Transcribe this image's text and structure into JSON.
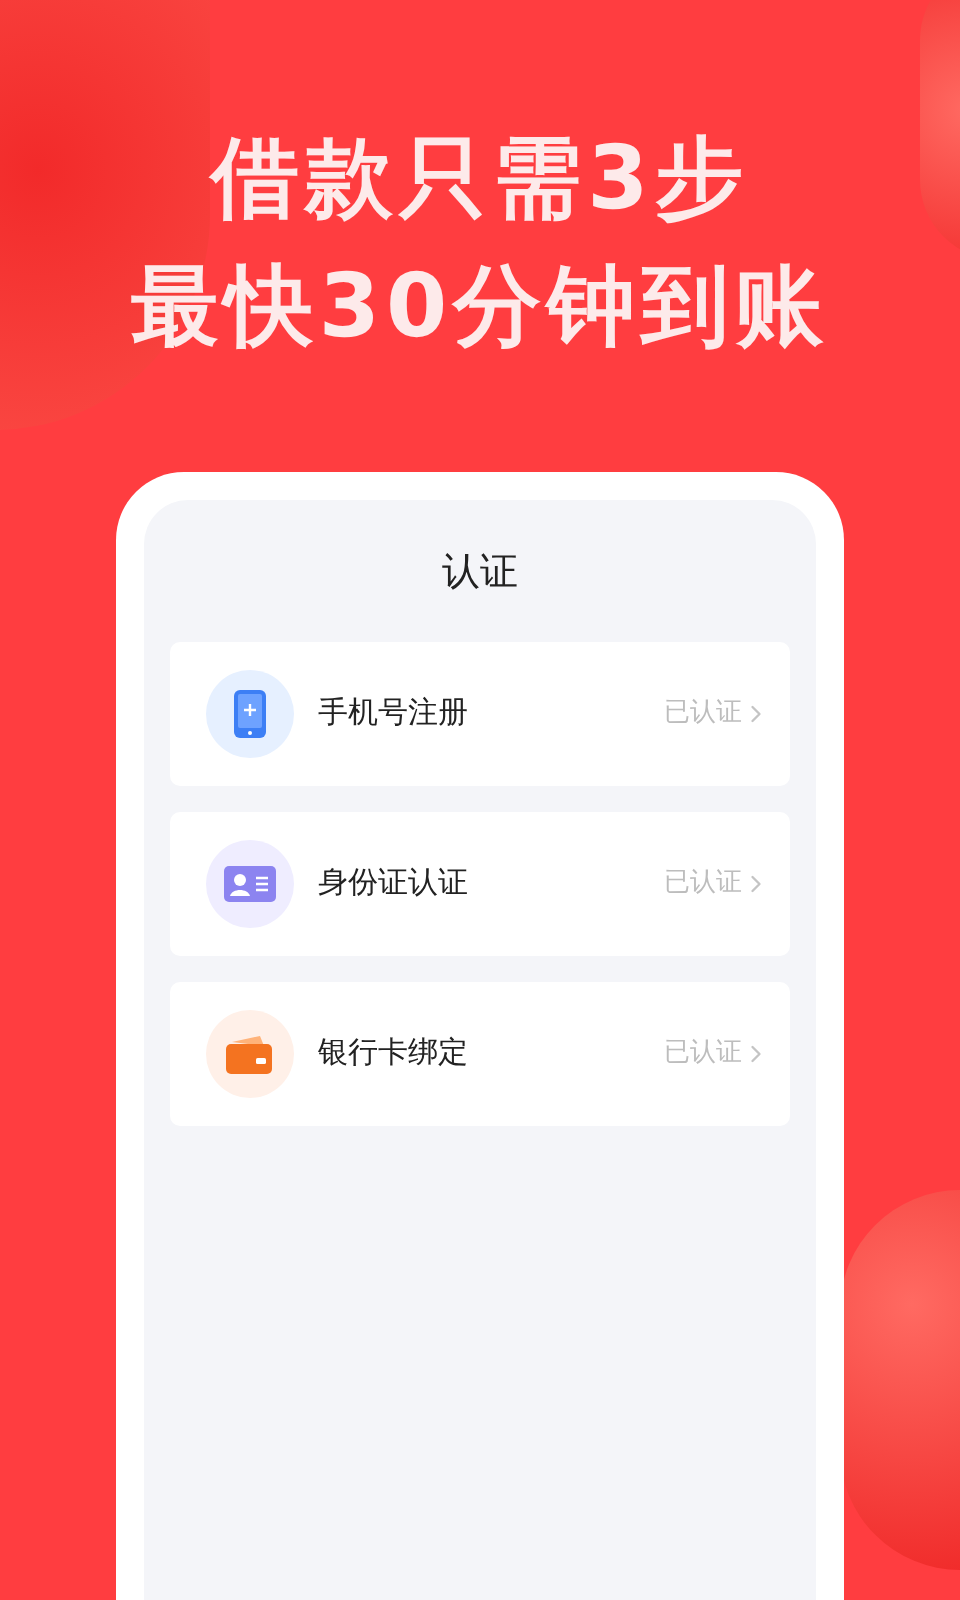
{
  "headline": [
    "借款只需3步",
    "最快30分钟到账"
  ],
  "screen": {
    "title": "认证",
    "items": [
      {
        "kind": "phone",
        "label": "手机号注册",
        "status": "已认证"
      },
      {
        "kind": "id",
        "label": "身份证认证",
        "status": "已认证"
      },
      {
        "kind": "card",
        "label": "银行卡绑定",
        "status": "已认证"
      }
    ]
  }
}
